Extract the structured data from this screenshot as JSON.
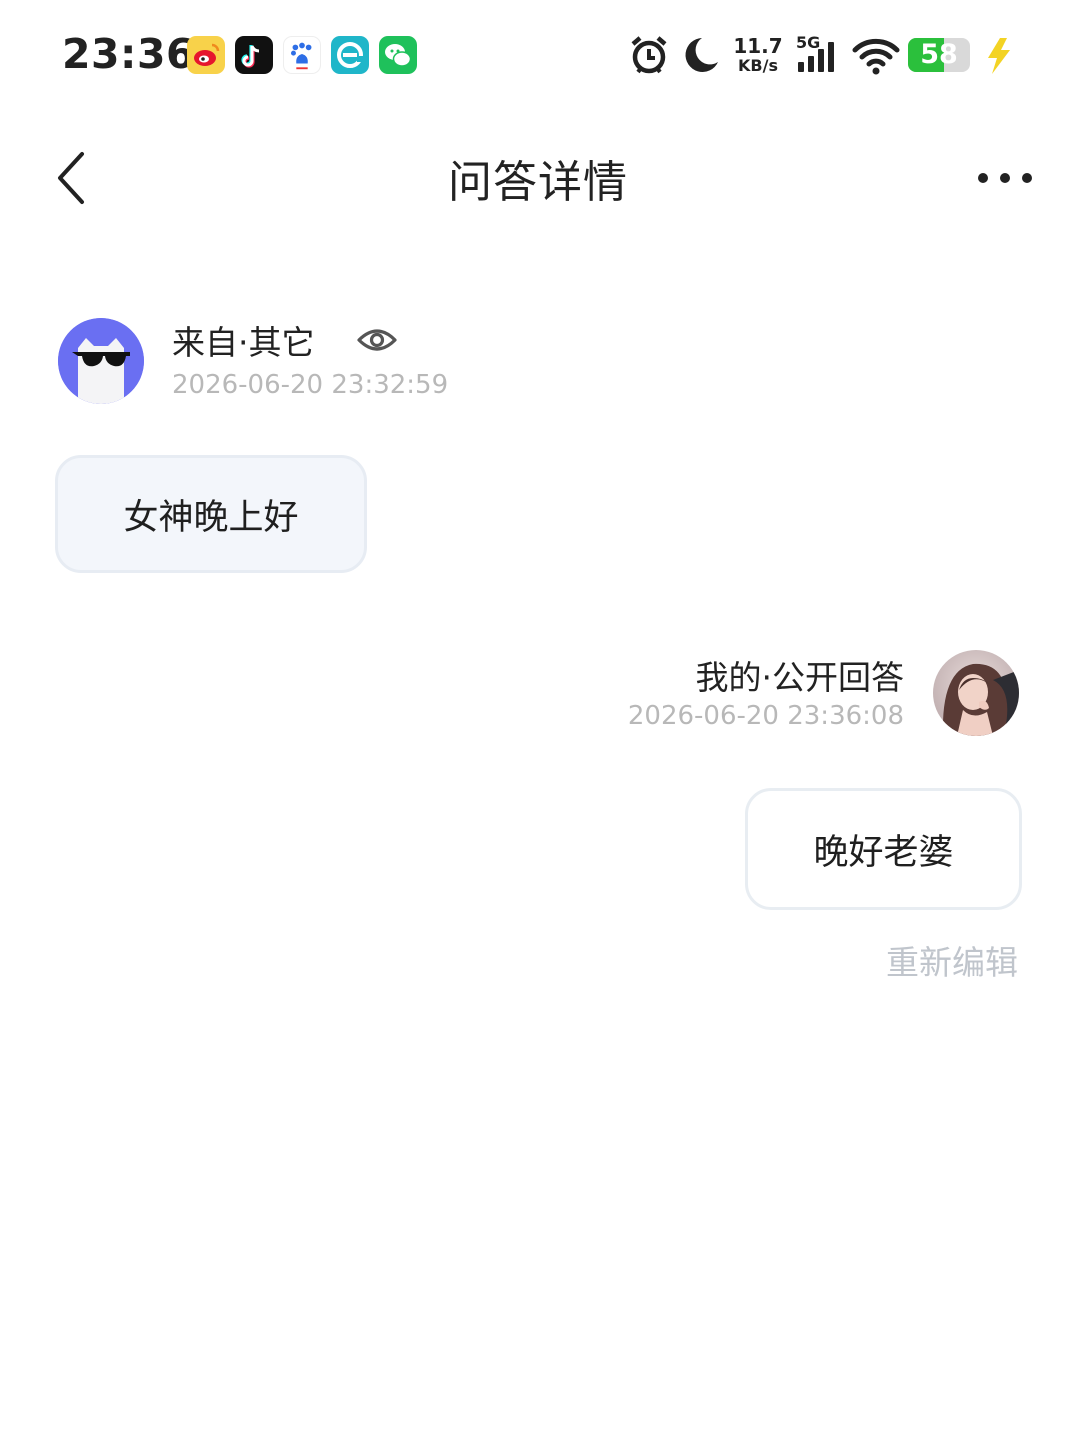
{
  "status_bar": {
    "time": "23:36",
    "apps": [
      "weibo-icon",
      "douyin-icon",
      "baidu-icon",
      "browser-icon",
      "wechat-icon"
    ],
    "net_speed_value": "11.7",
    "net_speed_unit": "KB/s",
    "network_type": "5G",
    "battery_level": "58",
    "battery_fraction": 0.58,
    "icons": [
      "alarm-icon",
      "moon-icon",
      "signal-icon",
      "wifi-icon",
      "battery-icon",
      "charging-icon"
    ]
  },
  "header": {
    "title": "问答详情"
  },
  "question": {
    "source": "来自·其它",
    "time": "2026-06-20 23:32:59",
    "text": "女神晚上好"
  },
  "answer": {
    "source": "我的·公开回答",
    "time": "2026-06-20 23:36:08",
    "text": "晚好老婆",
    "reedit_label": "重新编辑"
  },
  "colors": {
    "accent": "#6a6ff2",
    "battery": "#2bc03c",
    "muted_text": "#b8b8b8",
    "question_bubble": "#f3f6fb"
  }
}
